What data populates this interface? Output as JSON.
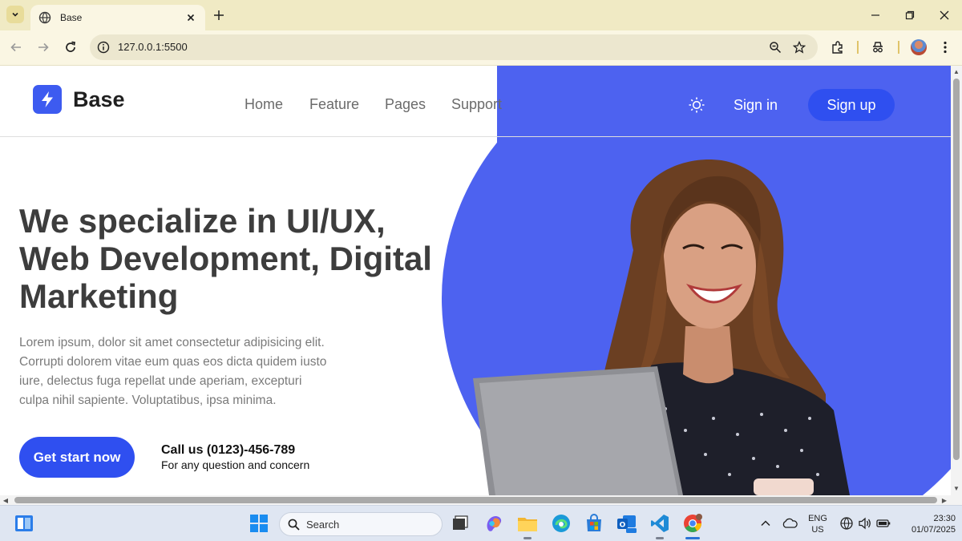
{
  "browser": {
    "tab_title": "Base",
    "url": "127.0.0.1:5500"
  },
  "site": {
    "logo_text": "Base",
    "nav_links": [
      "Home",
      "Feature",
      "Pages",
      "Support"
    ],
    "sign_in": "Sign in",
    "sign_up": "Sign up"
  },
  "hero": {
    "title": "We specialize in UI/UX, Web Development, Digital Marketing",
    "description": "Lorem ipsum, dolor sit amet consectetur adipisicing elit. Corrupti dolorem vitae eum quas eos dicta quidem iusto iure, delectus fuga repellat unde aperiam, excepturi culpa nihil sapiente. Voluptatibus, ipsa minima.",
    "cta": "Get start now",
    "call_title": "Call us (0123)-456-789",
    "call_sub": "For any question and concern"
  },
  "taskbar": {
    "search_label": "Search",
    "lang_line1": "ENG",
    "lang_line2": "US",
    "time": "23:30",
    "date": "01/07/2025"
  },
  "colors": {
    "accent": "#4d62f0",
    "button": "#2f4ff0"
  }
}
